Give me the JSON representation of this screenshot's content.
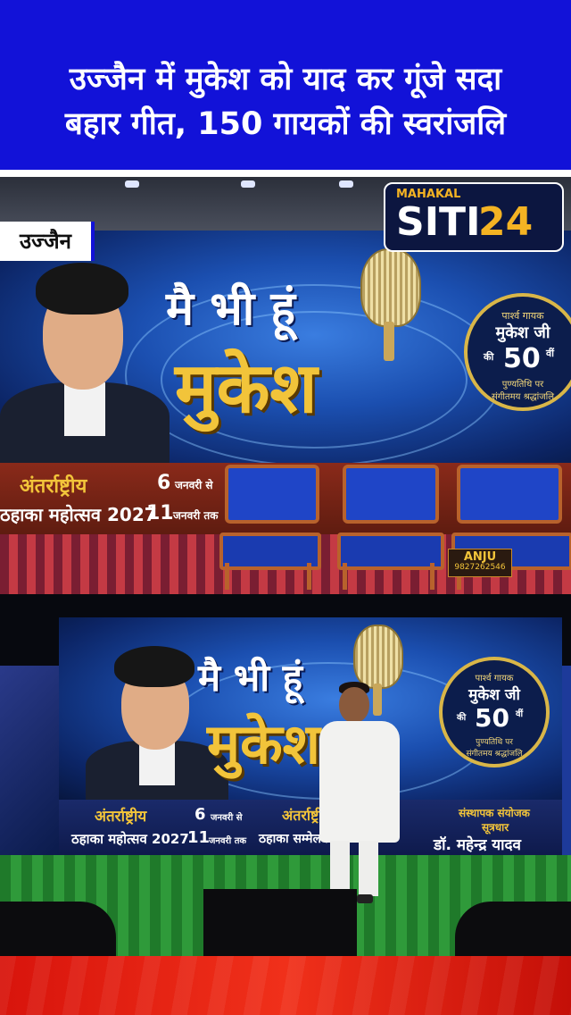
{
  "headline": {
    "line1": "उज्जैन में मुकेश को याद कर गूंजे सदा",
    "line2": "बहार गीत, 150 गायकों की स्वरांजलि"
  },
  "place_tag": "उज्जैन",
  "logo": {
    "tag": "MAHAKAL",
    "part1": "SITI",
    "part2": "24"
  },
  "banner": {
    "title_line1": "मै भी हूं",
    "title_line2": "मुकेश",
    "badge": {
      "line1": "पार्श्व गायक",
      "line2": "मुकेश जी",
      "line3": "की",
      "number": "50",
      "suffix": "वीं",
      "line4": "पुण्यतिथि पर",
      "line5": "संगीतमय श्रद्धांजलि"
    },
    "strip": {
      "event_line1": "अंतर्राष्ट्रीय",
      "event_line2": "ठहाका महोत्सव 2027",
      "date1_num": "6",
      "date1_text": "जनवरी से",
      "date2_num": "11",
      "date2_text": "जनवरी तक",
      "event2_line1": "अंतर्राष्ट्रीय",
      "event2_line2": "ठहाका सम्मेलन",
      "organizer_line1": "संस्थापक संयोजक",
      "organizer_line2": "सूत्रधार",
      "organizer_name": "डॉ. महेन्द्र यादव"
    }
  },
  "stage_sign": {
    "name": "ANJU",
    "number": "9827262546"
  },
  "colors": {
    "headline_bg": "#1212d8",
    "accent_gold": "#f2c43a",
    "footer_red": "#e2200f"
  }
}
